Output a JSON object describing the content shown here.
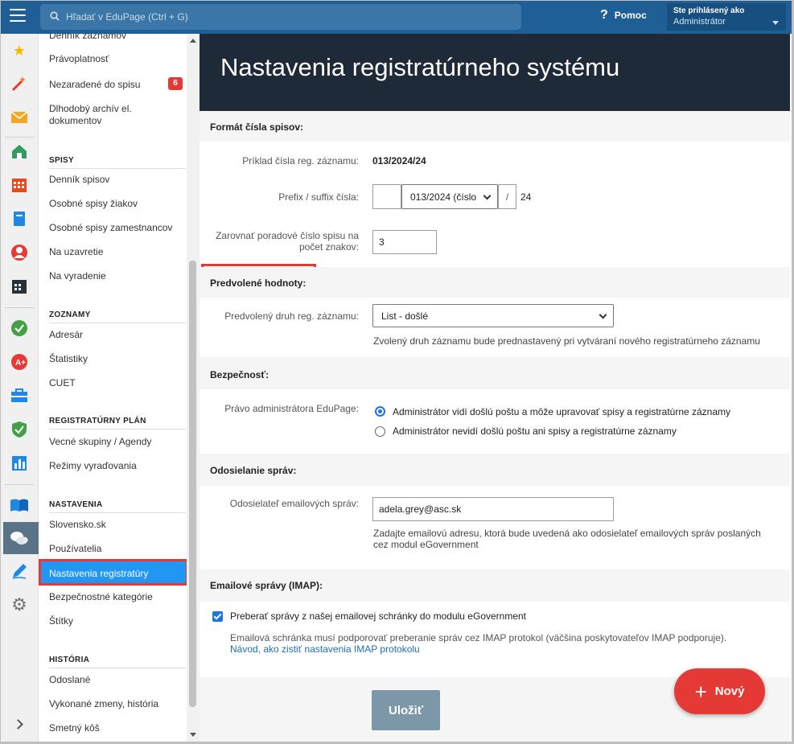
{
  "topbar": {
    "search_placeholder": "Hľadať v EduPage (Ctrl + G)",
    "help_label": "Pomoc",
    "user_line1": "Ste prihlásený ako",
    "user_line2": "Administrátor"
  },
  "nav": {
    "items_top": [
      "Denník záznamov",
      "Právoplatnosť",
      "Nezaradené do spisu",
      "Dlhodobý archív el. dokumentov"
    ],
    "badge_unassigned": "6",
    "spisy": {
      "heading": "SPISY",
      "items": [
        "Denník spisov",
        "Osobné spisy žiakov",
        "Osobné spisy zamestnancov",
        "Na uzavretie",
        "Na vyradenie"
      ]
    },
    "zoznamy": {
      "heading": "ZOZNAMY",
      "items": [
        "Adresár",
        "Štatistiky",
        "CUET"
      ]
    },
    "plan": {
      "heading": "REGISTRATÚRNY PLÁN",
      "items": [
        "Vecné skupiny / Agendy",
        "Režimy vyraďovania"
      ]
    },
    "nastavenia": {
      "heading": "NASTAVENIA",
      "items": [
        "Slovensko.sk",
        "Používatelia",
        "Nastavenia registratúry",
        "Bezpečnostné kategórie",
        "Štítky"
      ]
    },
    "historia": {
      "heading": "HISTÓRIA",
      "items": [
        "Odoslané",
        "Vykonané zmeny, história",
        "Smetný kôš"
      ]
    }
  },
  "main": {
    "title": "Nastavenia registratúrneho systému",
    "format": {
      "heading": "Formát čísla spisov:",
      "example_label": "Príklad čísla reg. záznamu:",
      "example_value": "013/2024/24",
      "prefix_label": "Prefix / suffix čísla:",
      "prefix_value": "",
      "prefix_select": "013/2024 (číslo",
      "slash": "/",
      "suffix_value": "24",
      "align_label_1": "Zarovnať poradové číslo spisu na",
      "align_label_2": "počet znakov:",
      "align_value": "3"
    },
    "defaults": {
      "heading": "Predvolené hodnoty:",
      "type_label": "Predvolený druh reg. záznamu:",
      "type_value": "List - došlé",
      "type_hint": "Zvolený druh záznamu bude prednastavený pri vytváraní nového registratúrneho záznamu"
    },
    "security": {
      "heading": "Bezpečnosť:",
      "label": "Právo administrátora EduPage:",
      "option_yes": "Administrátor vidí došlú poštu a môže upravovať spisy a registratúrne záznamy",
      "option_no": "Administrátor nevidí došlú poštu ani spisy a registratúrne záznamy"
    },
    "sending": {
      "heading": "Odosielanie správ:",
      "label": "Odosielateľ emailových správ:",
      "value": "adela.grey@asc.sk",
      "hint_1": "Zadajte emailovú adresu, ktorá bude uvedená ako odosielateľ emailových správ poslaných",
      "hint_2": "cez modul eGovernment"
    },
    "imap": {
      "heading": "Emailové správy (IMAP):",
      "checkbox_label": "Preberať správy z našej emailovej schránky do modulu eGovernment",
      "note": "Emailová schránka musí podporovať preberanie správ cez IMAP protokol (väčšina poskytovateľov IMAP podporuje).",
      "link": "Návod, ako zistiť nastavenia IMAP protokolu"
    },
    "save_label": "Uložiť"
  },
  "fab": {
    "label": "Nový",
    "plus": "+"
  },
  "colors": {
    "topbar": "#1f5f95",
    "title_bg": "#1e2a38",
    "accent": "#2196f3",
    "highlight": "#e53935"
  }
}
